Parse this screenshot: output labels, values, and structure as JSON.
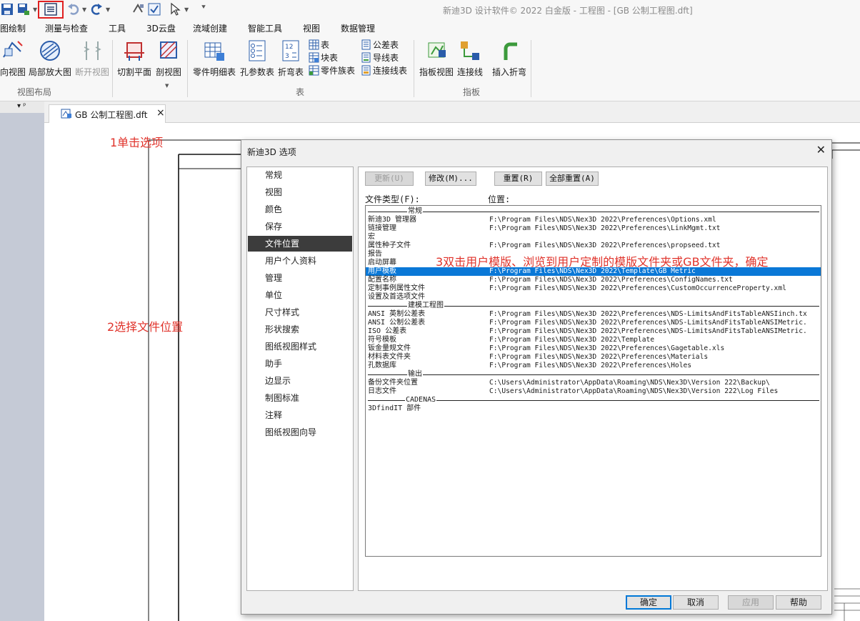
{
  "window": {
    "title": "新迪3D 设计软件© 2022 白金版 - 工程图 - [GB 公制工程图.dft]"
  },
  "quick_access": {
    "icons": [
      "save-icon",
      "save-as-icon",
      "options-icon",
      "undo-icon",
      "redo-icon",
      "update-icon",
      "select-icon",
      "customize-icon"
    ]
  },
  "menu": [
    {
      "label": "图绘制"
    },
    {
      "label": "测量与检查"
    },
    {
      "label": "工具"
    },
    {
      "label": "3D云盘"
    },
    {
      "label": "流域创建"
    },
    {
      "label": "智能工具"
    },
    {
      "label": "视图"
    },
    {
      "label": "数据管理"
    }
  ],
  "ribbon": {
    "view_layout": {
      "group_label": "视图布局",
      "buttons": [
        {
          "label": "向视图"
        },
        {
          "label": "局部放大图"
        },
        {
          "label": "断开视图"
        },
        {
          "label": "切割平面"
        },
        {
          "label": "剖视图"
        }
      ]
    },
    "table": {
      "group_label": "表",
      "buttons": [
        {
          "label": "零件明细表"
        },
        {
          "label": "孔参数表"
        },
        {
          "label": "折弯表"
        }
      ],
      "small": [
        {
          "label": "表"
        },
        {
          "label": "块表"
        },
        {
          "label": "零件族表"
        },
        {
          "label": "公差表"
        },
        {
          "label": "导线表"
        },
        {
          "label": "连接线表"
        }
      ]
    },
    "harness": {
      "group_label": "指板",
      "buttons": [
        {
          "label": "指板视图"
        },
        {
          "label": "连接线"
        },
        {
          "label": "插入折弯"
        }
      ]
    }
  },
  "doc_tab": {
    "label": "GB 公制工程图.dft",
    "close": "×"
  },
  "dock": {
    "pin": "▾ ᵖ"
  },
  "annotations": {
    "step1": "1单击选项",
    "step2": "2选择文件位置",
    "step3": "3双击用户模版、浏览到用户定制的模版文件夹或GB文件夹，确定"
  },
  "dialog": {
    "title": "新迪3D 选项",
    "close": "✕",
    "categories": [
      {
        "label": "常规"
      },
      {
        "label": "视图"
      },
      {
        "label": "颜色"
      },
      {
        "label": "保存"
      },
      {
        "label": "文件位置"
      },
      {
        "label": "用户个人资料"
      },
      {
        "label": "管理"
      },
      {
        "label": "单位"
      },
      {
        "label": "尺寸样式"
      },
      {
        "label": "形状搜索"
      },
      {
        "label": "图纸视图样式"
      },
      {
        "label": "助手"
      },
      {
        "label": "边显示"
      },
      {
        "label": "制图标准"
      },
      {
        "label": "注释"
      },
      {
        "label": "图纸视图向导"
      }
    ],
    "selected_category": "文件位置",
    "panel_buttons": {
      "update": "更新(U)",
      "modify": "修改(M)...",
      "reset": "重置(R)",
      "reset_all": "全部重置(A)"
    },
    "col_type": "文件类型(F):",
    "col_location": "位置:",
    "sections": [
      {
        "title": "常规",
        "rows": [
          {
            "name": "新迪3D 管理器",
            "path": "F:\\Program Files\\NDS\\Nex3D 2022\\Preferences\\Options.xml"
          },
          {
            "name": "链接管理",
            "path": "F:\\Program Files\\NDS\\Nex3D 2022\\Preferences\\LinkMgmt.txt"
          },
          {
            "name": "宏",
            "path": ""
          },
          {
            "name": "属性种子文件",
            "path": "F:\\Program Files\\NDS\\Nex3D 2022\\Preferences\\propseed.txt"
          },
          {
            "name": "报告",
            "path": ""
          },
          {
            "name": "启动屏幕",
            "path": ""
          },
          {
            "name": "用户模板",
            "path": "F:\\Program Files\\NDS\\Nex3D 2022\\Template\\GB Metric",
            "selected": true
          },
          {
            "name": "配置名称",
            "path": "F:\\Program Files\\NDS\\Nex3D 2022\\Preferences\\ConfigNames.txt"
          },
          {
            "name": "定制事例属性文件",
            "path": "F:\\Program Files\\NDS\\Nex3D 2022\\Preferences\\CustomOccurrenceProperty.xml"
          },
          {
            "name": "设置及首选项文件",
            "path": ""
          }
        ]
      },
      {
        "title": "建模工程图",
        "rows": [
          {
            "name": "ANSI 英制公差表",
            "path": "F:\\Program Files\\NDS\\Nex3D 2022\\Preferences\\NDS-LimitsAndFitsTableANSIinch.tx"
          },
          {
            "name": "ANSI 公制公差表",
            "path": "F:\\Program Files\\NDS\\Nex3D 2022\\Preferences\\NDS-LimitsAndFitsTableANSIMetric."
          },
          {
            "name": "ISO 公差表",
            "path": "F:\\Program Files\\NDS\\Nex3D 2022\\Preferences\\NDS-LimitsAndFitsTableANSIMetric."
          },
          {
            "name": "符号模板",
            "path": "F:\\Program Files\\NDS\\Nex3D 2022\\Template"
          },
          {
            "name": "钣金量规文件",
            "path": "F:\\Program Files\\NDS\\Nex3D 2022\\Preferences\\Gagetable.xls"
          },
          {
            "name": "材料表文件夹",
            "path": "F:\\Program Files\\NDS\\Nex3D 2022\\Preferences\\Materials"
          },
          {
            "name": "孔数据库",
            "path": "F:\\Program Files\\NDS\\Nex3D 2022\\Preferences\\Holes"
          }
        ]
      },
      {
        "title": "输出",
        "rows": [
          {
            "name": "备份文件夹位置",
            "path": "C:\\Users\\Administrator\\AppData\\Roaming\\NDS\\Nex3D\\Version 222\\Backup\\"
          },
          {
            "name": "日志文件",
            "path": "C:\\Users\\Administrator\\AppData\\Roaming\\NDS\\Nex3D\\Version 222\\Log Files"
          }
        ]
      },
      {
        "title": "CADENAS",
        "rows": [
          {
            "name": "3DfindIT 部件",
            "path": ""
          }
        ]
      }
    ],
    "footer": {
      "ok": "确定",
      "cancel": "取消",
      "apply": "应用",
      "help": "帮助"
    }
  },
  "colors": {
    "selection": "#0a78d7",
    "annotation": "#e0332b",
    "category_selected": "#3c3c3c",
    "highlight_box": "#e02020"
  }
}
